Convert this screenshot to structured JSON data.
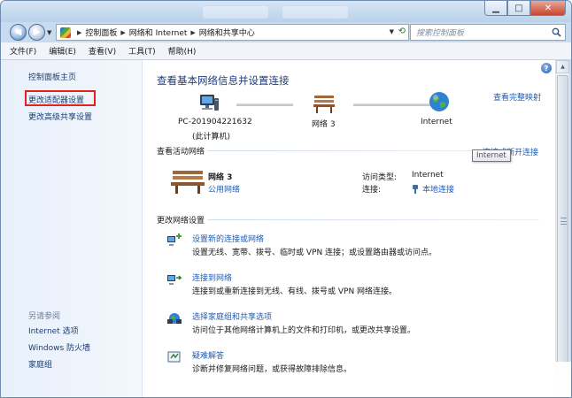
{
  "address_bar": {
    "crumbs": [
      "控制面板",
      "网络和 Internet",
      "网络和共享中心"
    ],
    "search_placeholder": "搜索控制面板"
  },
  "menubar": {
    "items": [
      "文件(F)",
      "编辑(E)",
      "查看(V)",
      "工具(T)",
      "帮助(H)"
    ]
  },
  "sidebar": {
    "home": "控制面板主页",
    "change_adapter": "更改适配器设置",
    "advanced_sharing": "更改高级共享设置",
    "see_also_heading": "另请参阅",
    "see_also": [
      "Internet 选项",
      "Windows 防火墙",
      "家庭组"
    ]
  },
  "main": {
    "title": "查看基本网络信息并设置连接",
    "full_map_link": "查看完整映射",
    "map": {
      "computer_name": "PC-201904221632",
      "computer_note": "(此计算机)",
      "network_name": "网络  3",
      "internet_label": "Internet"
    },
    "active_networks_heading": "查看活动网络",
    "connect_disconnect_link": "连接或断开连接",
    "tooltip": "Internet",
    "active_network": {
      "name": "网络  3",
      "type": "公用网络",
      "access_type_label": "访问类型:",
      "access_type_value": "Internet",
      "connections_label": "连接:",
      "connections_value": "本地连接"
    },
    "change_settings_heading": "更改网络设置",
    "tasks": [
      {
        "link": "设置新的连接或网络",
        "desc": "设置无线、宽带、拨号、临时或 VPN 连接；或设置路由器或访问点。"
      },
      {
        "link": "连接到网络",
        "desc": "连接到或重新连接到无线、有线、拨号或 VPN 网络连接。"
      },
      {
        "link": "选择家庭组和共享选项",
        "desc": "访问位于其他网络计算机上的文件和打印机，或更改共享设置。"
      },
      {
        "link": "疑难解答",
        "desc": "诊断并修复网络问题，或获得故障排除信息。"
      }
    ]
  },
  "colors": {
    "link": "#1f5cb3",
    "title": "#1e3b7a",
    "highlight_box": "#e1231e",
    "sidebar_bg": "#e8f0fa"
  }
}
